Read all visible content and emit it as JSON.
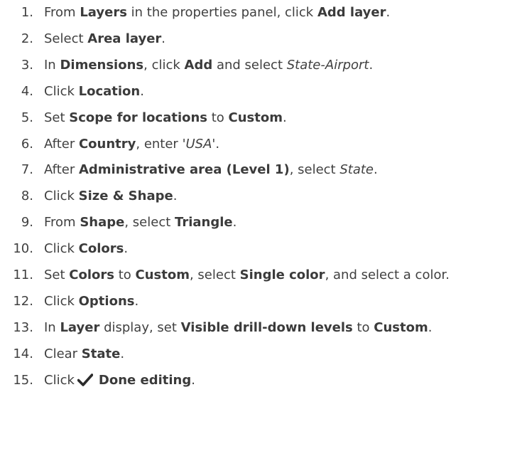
{
  "steps": [
    {
      "number": "1.",
      "parts": [
        {
          "t": "From "
        },
        {
          "t": "Layers",
          "s": "b"
        },
        {
          "t": " in the properties panel, click "
        },
        {
          "t": "Add layer",
          "s": "b"
        },
        {
          "t": "."
        }
      ]
    },
    {
      "number": "2.",
      "parts": [
        {
          "t": "Select "
        },
        {
          "t": "Area layer",
          "s": "b"
        },
        {
          "t": "."
        }
      ]
    },
    {
      "number": "3.",
      "parts": [
        {
          "t": "In "
        },
        {
          "t": "Dimensions",
          "s": "b"
        },
        {
          "t": ", click "
        },
        {
          "t": "Add",
          "s": "b"
        },
        {
          "t": " and select "
        },
        {
          "t": "State-Airport",
          "s": "i"
        },
        {
          "t": "."
        }
      ]
    },
    {
      "number": "4.",
      "parts": [
        {
          "t": "Click "
        },
        {
          "t": "Location",
          "s": "b"
        },
        {
          "t": "."
        }
      ]
    },
    {
      "number": "5.",
      "parts": [
        {
          "t": "Set "
        },
        {
          "t": "Scope for locations",
          "s": "b"
        },
        {
          "t": " to "
        },
        {
          "t": "Custom",
          "s": "b"
        },
        {
          "t": "."
        }
      ]
    },
    {
      "number": "6.",
      "parts": [
        {
          "t": "After "
        },
        {
          "t": "Country",
          "s": "b"
        },
        {
          "t": ", enter "
        },
        {
          "t": "'USA'",
          "s": "i"
        },
        {
          "t": "."
        }
      ]
    },
    {
      "number": "7.",
      "parts": [
        {
          "t": "After "
        },
        {
          "t": "Administrative area (Level 1)",
          "s": "b"
        },
        {
          "t": ", select "
        },
        {
          "t": "State",
          "s": "i"
        },
        {
          "t": "."
        }
      ]
    },
    {
      "number": "8.",
      "parts": [
        {
          "t": "Click "
        },
        {
          "t": "Size & Shape",
          "s": "b"
        },
        {
          "t": "."
        }
      ]
    },
    {
      "number": "9.",
      "parts": [
        {
          "t": "From "
        },
        {
          "t": "Shape",
          "s": "b"
        },
        {
          "t": ", select "
        },
        {
          "t": "Triangle",
          "s": "b"
        },
        {
          "t": "."
        }
      ]
    },
    {
      "number": "10.",
      "parts": [
        {
          "t": "Click "
        },
        {
          "t": "Colors",
          "s": "b"
        },
        {
          "t": "."
        }
      ]
    },
    {
      "number": "11.",
      "parts": [
        {
          "t": "Set "
        },
        {
          "t": "Colors",
          "s": "b"
        },
        {
          "t": " to "
        },
        {
          "t": "Custom",
          "s": "b"
        },
        {
          "t": ", select "
        },
        {
          "t": "Single color",
          "s": "b"
        },
        {
          "t": ", and select a color."
        }
      ]
    },
    {
      "number": "12.",
      "parts": [
        {
          "t": "Click "
        },
        {
          "t": "Options",
          "s": "b"
        },
        {
          "t": "."
        }
      ]
    },
    {
      "number": "13.",
      "parts": [
        {
          "t": "In "
        },
        {
          "t": "Layer",
          "s": "b"
        },
        {
          "t": " display, set "
        },
        {
          "t": "Visible drill-down levels",
          "s": "b"
        },
        {
          "t": " to "
        },
        {
          "t": "Custom",
          "s": "b"
        },
        {
          "t": "."
        }
      ]
    },
    {
      "number": "14.",
      "parts": [
        {
          "t": "Clear "
        },
        {
          "t": "State",
          "s": "b"
        },
        {
          "t": "."
        }
      ]
    },
    {
      "number": "15.",
      "parts": [
        {
          "t": "Click"
        },
        {
          "icon": "checkmark-icon"
        },
        {
          "t": "Done editing",
          "s": "b"
        },
        {
          "t": "."
        }
      ]
    }
  ]
}
